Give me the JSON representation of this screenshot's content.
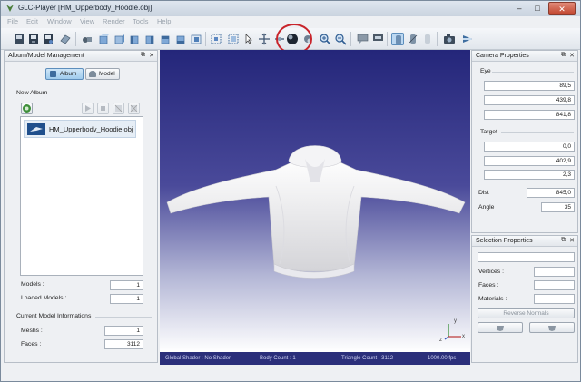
{
  "window": {
    "title": "GLC-Player [HM_Upperbody_Hoodie.obj]",
    "min": "–",
    "max": "□",
    "close": "✕"
  },
  "menu": [
    "File",
    "Edit",
    "Window",
    "View",
    "Render",
    "Tools",
    "Help"
  ],
  "album_panel": {
    "title": "Album/Model Management",
    "album_tab": "Album",
    "model_tab": "Model",
    "new_album": "New Album",
    "list_item": "HM_Upperbody_Hoodie.obj",
    "models_label": "Models :",
    "models_value": "1",
    "loaded_models_label": "Loaded Models :",
    "loaded_models_value": "1",
    "current_info": "Current Model Informations",
    "meshs_label": "Meshs :",
    "meshs_value": "1",
    "faces_label": "Faces :",
    "faces_value": "3112"
  },
  "camera_panel": {
    "title": "Camera Properties",
    "eye": "Eye",
    "eye_x": "89,5",
    "eye_y": "439,8",
    "eye_z": "841,8",
    "target": "Target",
    "target_x": "0,0",
    "target_y": "402,9",
    "target_z": "2,3",
    "dist_label": "Dist",
    "dist_value": "845,0",
    "angle_label": "Angle",
    "angle_value": "35"
  },
  "selection_panel": {
    "title": "Selection Properties",
    "vertices_label": "Vertices :",
    "faces_label": "Faces :",
    "materials_label": "Materials :",
    "reverse_normals": "Reverse Normals"
  },
  "status": {
    "shader": "Global Shader : No Shader",
    "body_count": "Body Count : 1",
    "triangle_count": "Triangle Count : 3112",
    "fps": "1000.00 fps"
  },
  "axes": {
    "x": "x",
    "y": "y",
    "z": "z"
  },
  "colors": {
    "highlight": "#c8242b",
    "viewport_top": "#24267a",
    "status_bg": "#2b2f7a"
  }
}
